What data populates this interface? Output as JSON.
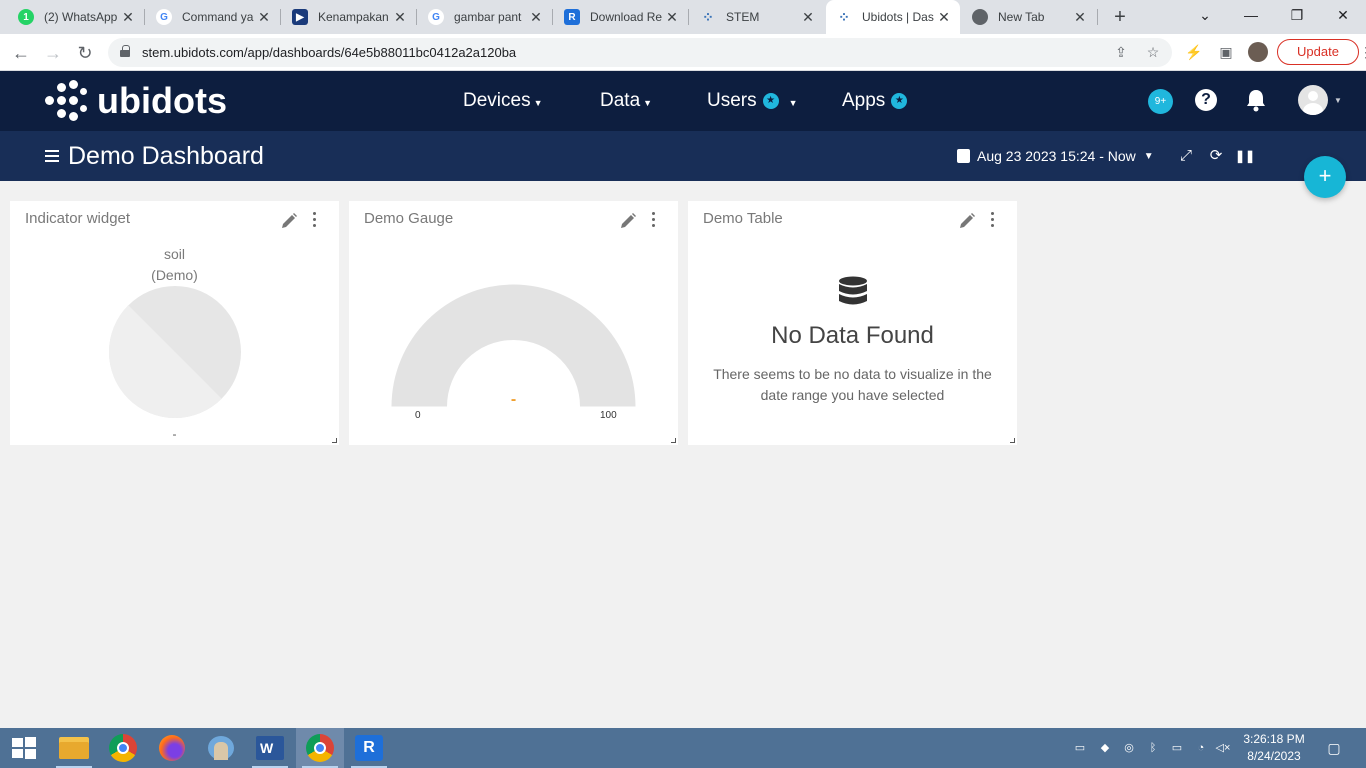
{
  "browser": {
    "tabs": [
      {
        "title": "(2) WhatsApp",
        "icon": "whatsapp-icon"
      },
      {
        "title": "Command ya",
        "icon": "google-icon"
      },
      {
        "title": "Kenampakan",
        "icon": "kenampakan-icon"
      },
      {
        "title": "gambar pant",
        "icon": "google-icon"
      },
      {
        "title": "Download Re",
        "icon": "download-icon"
      },
      {
        "title": "STEM",
        "icon": "ubidots-icon"
      },
      {
        "title": "Ubidots | Das",
        "icon": "ubidots-icon"
      },
      {
        "title": "New Tab",
        "icon": "chrome-icon"
      }
    ],
    "whatsapp_badge": "1",
    "url": "stem.ubidots.com/app/dashboards/64e5b88011bc0412a2a120ba",
    "update_label": "Update"
  },
  "app": {
    "logo_text": "ubidots",
    "nav": {
      "devices": "Devices",
      "data": "Data",
      "users": "Users",
      "apps": "Apps"
    },
    "notif_count": "9+",
    "help": "?"
  },
  "dashboard": {
    "title": "Demo Dashboard",
    "date_range": "Aug 23 2023 15:24 - Now"
  },
  "widgets": {
    "indicator": {
      "title": "Indicator widget",
      "variable": "soil",
      "device": "(Demo)",
      "value": "-"
    },
    "gauge": {
      "title": "Demo Gauge",
      "min": "0",
      "max": "100",
      "value": "-"
    },
    "table": {
      "title": "Demo Table",
      "empty_title": "No Data Found",
      "empty_text": "There seems to be no data to visualize in the date range you have selected"
    }
  },
  "taskbar": {
    "time": "3:26:18 PM",
    "date": "8/24/2023"
  },
  "colors": {
    "nav_bg": "#0d1e3f",
    "dash_bar_bg": "#182e57",
    "accent": "#20b7dd",
    "fab": "#17b6d6",
    "update_red": "#d93025"
  }
}
